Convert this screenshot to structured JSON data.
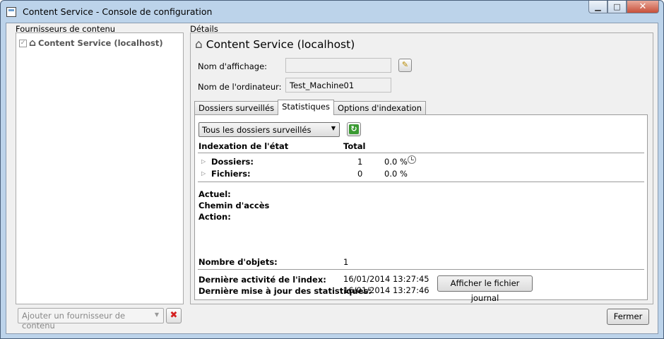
{
  "window": {
    "title": "Content Service - Console de configuration",
    "buttons": {
      "minimize": "▁",
      "maximize": "□",
      "close": "✕"
    }
  },
  "left": {
    "label": "Fournisseurs de contenu",
    "tree_item": "Content Service (localhost)",
    "add_provider_placeholder": "Ajouter un fournisseur de contenu"
  },
  "details": {
    "label": "Détails",
    "header": "Content Service (localhost)",
    "display_name_label": "Nom d'affichage:",
    "display_name_value": "",
    "computer_name_label": "Nom de l'ordinateur:",
    "computer_name_value": "Test_Machine01"
  },
  "tabs": [
    "Dossiers surveillés",
    "Statistiques",
    "Options d'indexation"
  ],
  "active_tab": "Statistiques",
  "stats": {
    "filter_selected": "Tous les dossiers surveillés",
    "col_state": "Indexation de l'état",
    "col_total": "Total",
    "rows": [
      {
        "label": "Dossiers:",
        "total": "1",
        "percent": "0.0 %"
      },
      {
        "label": "Fichiers:",
        "total": "0",
        "percent": "0.0 %"
      }
    ],
    "current_label": "Actuel:",
    "path_label": "Chemin d'accès",
    "action_label": "Action:",
    "object_count_label": "Nombre d'objets:",
    "object_count_value": "1",
    "last_index_label": "Dernière activité de l'index:",
    "last_index_value": "16/01/2014 13:27:45",
    "last_stats_label": "Dernière mise à jour des statistiques:",
    "last_stats_value": "16/01/2014 13:27:46",
    "view_log_label": "Afficher le fichier journal"
  },
  "footer": {
    "close_label": "Fermer"
  }
}
